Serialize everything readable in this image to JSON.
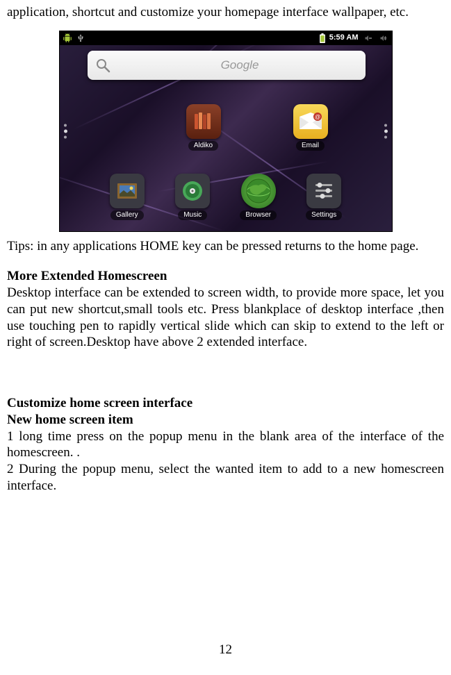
{
  "intro": "application, shortcut and customize your homepage interface wallpaper, etc.",
  "statusbar": {
    "time": "5:59 AM"
  },
  "search": {
    "placeholder": "Google"
  },
  "apps": {
    "aldiko": "Aldiko",
    "email": "Email",
    "gallery": "Gallery",
    "music": "Music",
    "browser": "Browser",
    "settings": "Settings"
  },
  "tips": "Tips: in any applications HOME key can be pressed returns to the home page.",
  "section1": {
    "head": "More Extended Homescreen",
    "body": "Desktop interface can be extended to screen width, to provide more space, let you can put new shortcut,small tools etc. Press blankplace of desktop interface ,then use touching pen to rapidly vertical slide which can skip to extend to the left or right of screen.Desktop have above 2 extended interface."
  },
  "section2": {
    "head": "Customize home screen interface",
    "sub": "New home screen item",
    "step1": "1 long time press on the popup menu in the blank area of the interface of the homescreen. .",
    "step2": "2 During the popup menu, select the wanted item to add to a new homescreen interface."
  },
  "pagenum": "12"
}
